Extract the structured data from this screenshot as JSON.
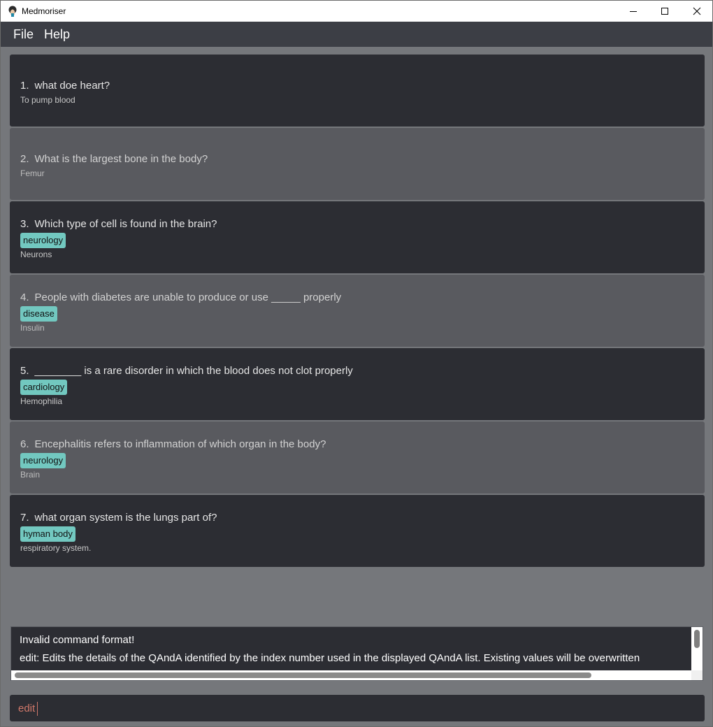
{
  "window": {
    "title": "Medmoriser"
  },
  "menu": {
    "file": "File",
    "help": "Help"
  },
  "cards": [
    {
      "num": "1.",
      "question": "what doe heart?",
      "tag": null,
      "answer": "To pump blood"
    },
    {
      "num": "2.",
      "question": "What is the largest bone in the body?",
      "tag": null,
      "answer": "Femur"
    },
    {
      "num": "3.",
      "question": "Which type of cell is found in the brain?",
      "tag": "neurology",
      "answer": "Neurons"
    },
    {
      "num": "4.",
      "question": "People with diabetes are unable to produce or use _____ properly",
      "tag": "disease",
      "answer": "Insulin"
    },
    {
      "num": "5.",
      "question": "________ is a rare disorder in which the blood does not clot properly",
      "tag": "cardiology",
      "answer": "Hemophilia"
    },
    {
      "num": "6.",
      "question": "Encephalitis refers to inflammation of which organ in the body?",
      "tag": "neurology",
      "answer": "Brain"
    },
    {
      "num": "7.",
      "question": "what organ system is the lungs part of?",
      "tag": "hyman body",
      "answer": "respiratory system."
    }
  ],
  "result": {
    "line1": "Invalid command format!",
    "line2": "edit: Edits the details of the QAndA identified by the index number used in the displayed QAndA list. Existing values will be overwritten"
  },
  "command": {
    "value": "edit"
  },
  "colors": {
    "card_dark": "#2c2d33",
    "card_light": "#595a5f",
    "tag": "#72c8c0",
    "background": "#75777b",
    "menubar": "#3c3e45",
    "command_text": "#d0786a"
  }
}
